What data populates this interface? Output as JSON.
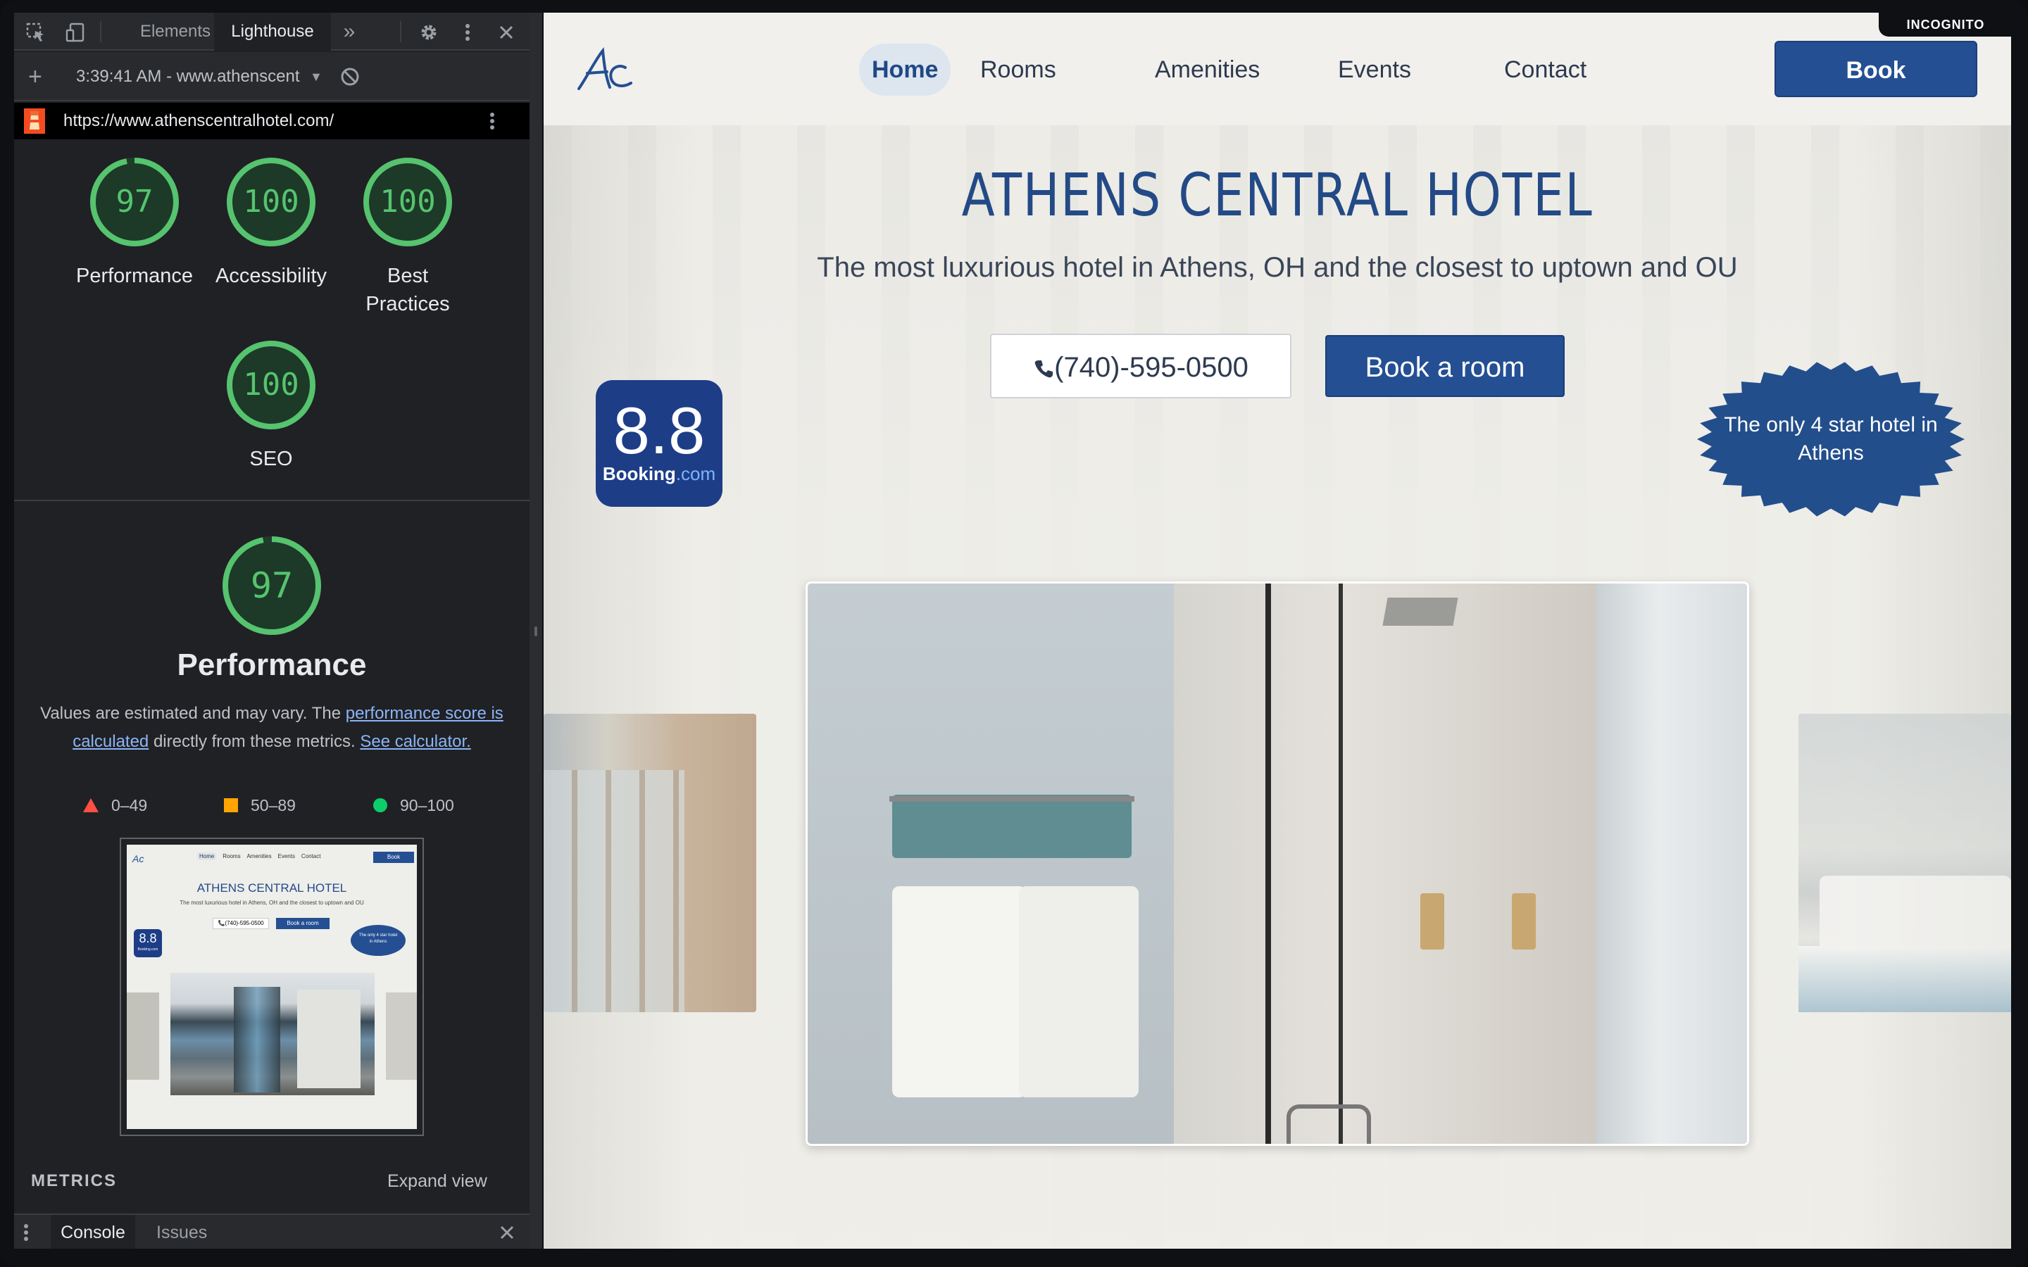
{
  "devtools": {
    "tabs": [
      "Elements",
      "Lighthouse"
    ],
    "more_tabs": "»",
    "time_and_url": "3:39:41 AM - www.athenscent",
    "audited_url": "https://www.athenscentralhotel.com/",
    "scores": [
      {
        "value": "97",
        "label": "Performance"
      },
      {
        "value": "100",
        "label": "Accessibility"
      },
      {
        "value": "100",
        "label": "Best Practices"
      },
      {
        "value": "100",
        "label": "SEO"
      }
    ],
    "performance": {
      "score": "97",
      "title": "Performance",
      "desc_prefix": "Values are estimated and may vary. The ",
      "link1": "performance score is calculated",
      "desc_mid": " directly from these metrics. ",
      "link2": "See calculator."
    },
    "legend": [
      "0–49",
      "50–89",
      "90–100"
    ],
    "metrics_label": "METRICS",
    "expand_label": "Expand view",
    "drawer_tabs": [
      "Console",
      "Issues"
    ],
    "thumbnail": {
      "nav": [
        "Home",
        "Rooms",
        "Amenities",
        "Events",
        "Contact"
      ],
      "book": "Book",
      "title": "ATHENS CENTRAL HOTEL",
      "sub": "The most luxurious hotel in Athens, OH and the closest to uptown and OU",
      "phone": "(740)-595-0500",
      "room": "Book a room",
      "badge": "8.8",
      "badge_brand": "Booking.com",
      "star": "The only 4 star hotel in Athens"
    },
    "colors": {
      "pass": "#0cce6b",
      "average": "#ffa400",
      "fail": "#ff4e42"
    }
  },
  "site": {
    "incognito": "INCOGNITO",
    "nav": [
      "Home",
      "Rooms",
      "Amenities",
      "Events",
      "Contact"
    ],
    "book": "Book",
    "title": "ATHENS CENTRAL HOTEL",
    "subtitle": "The most luxurious hotel in Athens, OH and the closest to uptown and OU",
    "phone": "(740)-595-0500",
    "book_room": "Book a room",
    "rating": {
      "score": "8.8",
      "brand_a": "Booking",
      "brand_b": ".com"
    },
    "star_text": "The only 4 star hotel in Athens",
    "colors": {
      "primary": "#244f93",
      "title": "#234a86",
      "background": "#efeee9"
    }
  }
}
